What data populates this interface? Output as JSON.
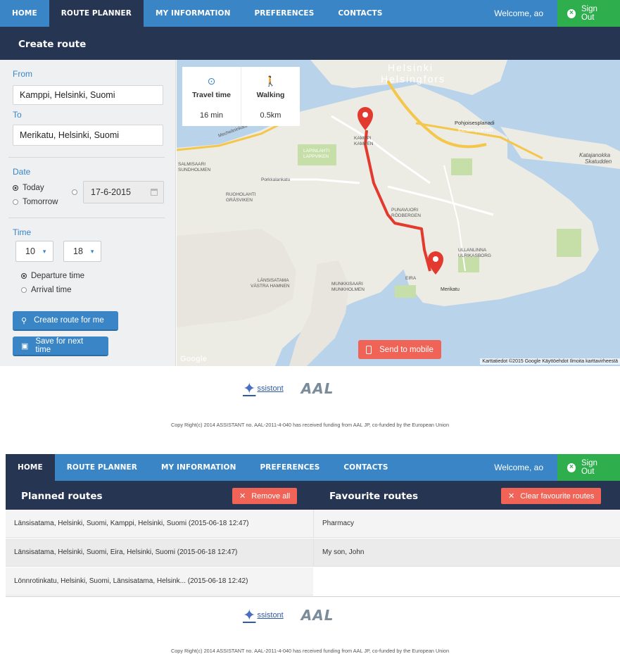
{
  "nav": {
    "items": [
      "HOME",
      "ROUTE PLANNER",
      "MY INFORMATION",
      "PREFERENCES",
      "CONTACTS"
    ],
    "welcome": "Welcome, ao",
    "sign_out": "Sign Out"
  },
  "screen1": {
    "active_tab": "ROUTE PLANNER",
    "title": "Create route",
    "from_label": "From",
    "from_value": "Kamppi, Helsinki, Suomi",
    "to_label": "To",
    "to_value": "Merikatu, Helsinki, Suomi",
    "date_label": "Date",
    "today": "Today",
    "tomorrow": "Tomorrow",
    "date_value": "17-6-2015",
    "time_label": "Time",
    "hour": "10",
    "minute": "18",
    "departure": "Departure time",
    "arrival": "Arrival time",
    "create_btn": "Create route for me",
    "save_btn": "Save for next time",
    "travel_time_label": "Travel time",
    "travel_time_value": "16 min",
    "walking_label": "Walking",
    "walking_value": "0.5km",
    "send_mobile": "Send to mobile",
    "map_attrib": "Karttatiedot ©2015 Google   Käyttöehdot   Ilmoita karttavirheestä",
    "google_mark": "Google",
    "map_labels": [
      "Helsinki",
      "Helsingfors",
      "KAMPPI",
      "KAMPEN",
      "PUNAVUORI",
      "RÖDBERGEN",
      "ULLANLINNA",
      "ULRIKASBORG",
      "LÄNSISATAMA",
      "VÄSTRA HAMNEN",
      "Katajanokka",
      "Skatudden",
      "SALMISAARI",
      "SUNDHOLMEN",
      "RUOHOLAHTI",
      "GRÄSVIKEN",
      "LAPINLAHTI",
      "LAPPVIKEN",
      "MUNKKISAARI",
      "MUNKHOLMEN",
      "EIRA",
      "Merikatu",
      "Pohjoisesplanadi",
      "Eteläesplanadi",
      "Porkkalankatu",
      "Mechelininkatu"
    ]
  },
  "footer": {
    "assistont": "ssistont",
    "aal": "AAL",
    "copyright": "Copy Right(c) 2014 ASSISTANT no. AAL-2011-4-040 has received funding from AAL JP, co-funded by the European Union"
  },
  "screen2": {
    "active_tab": "HOME",
    "planned_title": "Planned routes",
    "remove_all": "Remove all",
    "favourite_title": "Favourite routes",
    "clear_fav": "Clear favourite routes",
    "planned": [
      "Länsisatama, Helsinki, Suomi, Kamppi, Helsinki, Suomi (2015-06-18 12:47)",
      "Länsisatama, Helsinki, Suomi, Eira, Helsinki, Suomi (2015-06-18 12:47)",
      "Lönnrotinkatu, Helsinki, Suomi, Länsisatama, Helsink... (2015-06-18 12:42)"
    ],
    "favourites": [
      "Pharmacy",
      "My son, John"
    ]
  },
  "colors": {
    "nav": "#3a85c6",
    "dark": "#263552",
    "green": "#2fae4e",
    "red": "#f06458",
    "route": "#e23a2e"
  }
}
